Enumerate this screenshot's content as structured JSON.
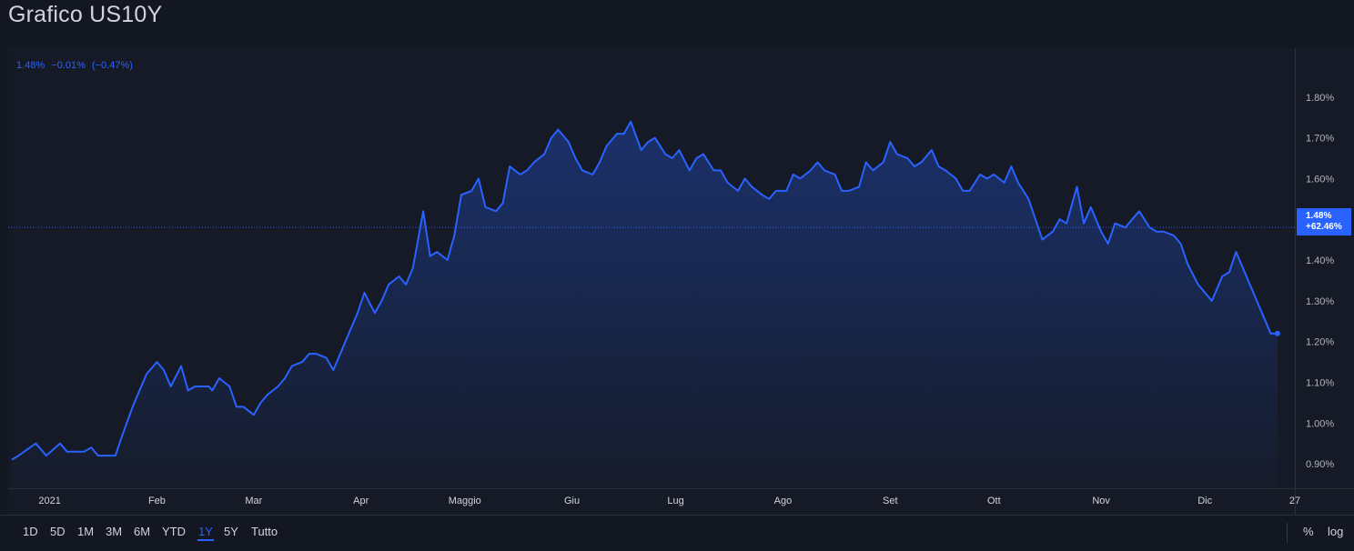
{
  "page": {
    "title": "Grafico US10Y"
  },
  "legend": {
    "value": "1.48%",
    "change": "−0.01%",
    "change_pct": "(−0.47%)"
  },
  "price_label": {
    "value": "1.48%",
    "change": "+62.46%"
  },
  "toolbar": {
    "ranges": [
      {
        "label": "1D",
        "active": false
      },
      {
        "label": "5D",
        "active": false
      },
      {
        "label": "1M",
        "active": false
      },
      {
        "label": "3M",
        "active": false
      },
      {
        "label": "6M",
        "active": false
      },
      {
        "label": "YTD",
        "active": false
      },
      {
        "label": "1Y",
        "active": true
      },
      {
        "label": "5Y",
        "active": false
      },
      {
        "label": "Tutto",
        "active": false
      }
    ],
    "percent_label": "%",
    "log_label": "log"
  },
  "colors": {
    "line": "#2962ff",
    "background": "#131722",
    "panel": "#151a26",
    "text": "#d1d4dc",
    "axis_text": "#b2b5be"
  },
  "chart_data": {
    "type": "area",
    "title": "",
    "xlabel": "",
    "ylabel": "",
    "x_tick_labels": [
      "2021",
      "Feb",
      "Mar",
      "Apr",
      "Maggio",
      "Giu",
      "Lug",
      "Ago",
      "Set",
      "Ott",
      "Nov",
      "Dic",
      "27"
    ],
    "y_tick_labels": [
      "0.90%",
      "1.00%",
      "1.10%",
      "1.20%",
      "1.30%",
      "1.40%",
      "1.50%",
      "1.60%",
      "1.70%",
      "1.80%"
    ],
    "ylim": [
      0.84,
      1.92
    ],
    "xlim": [
      "2020-12-20",
      "2021-12-27"
    ],
    "grid": false,
    "last_value": 1.48,
    "series": [
      {
        "points": [
          [
            "2020-12-21",
            0.91
          ],
          [
            "2020-12-23",
            0.92
          ],
          [
            "2020-12-28",
            0.95
          ],
          [
            "2020-12-31",
            0.92
          ],
          [
            "2021-01-04",
            0.95
          ],
          [
            "2021-01-06",
            0.93
          ],
          [
            "2021-01-08",
            0.93
          ],
          [
            "2021-01-11",
            0.93
          ],
          [
            "2021-01-13",
            0.94
          ],
          [
            "2021-01-15",
            0.92
          ],
          [
            "2021-01-19",
            0.92
          ],
          [
            "2021-01-20",
            0.92
          ],
          [
            "2021-01-22",
            0.97
          ],
          [
            "2021-01-25",
            1.04
          ],
          [
            "2021-01-27",
            1.08
          ],
          [
            "2021-01-29",
            1.12
          ],
          [
            "2021-02-01",
            1.15
          ],
          [
            "2021-02-03",
            1.13
          ],
          [
            "2021-02-05",
            1.09
          ],
          [
            "2021-02-08",
            1.14
          ],
          [
            "2021-02-10",
            1.08
          ],
          [
            "2021-02-12",
            1.09
          ],
          [
            "2021-02-16",
            1.09
          ],
          [
            "2021-02-17",
            1.08
          ],
          [
            "2021-02-19",
            1.11
          ],
          [
            "2021-02-22",
            1.09
          ],
          [
            "2021-02-24",
            1.04
          ],
          [
            "2021-02-26",
            1.04
          ],
          [
            "2021-03-01",
            1.02
          ],
          [
            "2021-03-03",
            1.05
          ],
          [
            "2021-03-05",
            1.07
          ],
          [
            "2021-03-08",
            1.09
          ],
          [
            "2021-03-10",
            1.11
          ],
          [
            "2021-03-12",
            1.14
          ],
          [
            "2021-03-15",
            1.15
          ],
          [
            "2021-03-17",
            1.17
          ],
          [
            "2021-03-19",
            1.17
          ],
          [
            "2021-03-22",
            1.16
          ],
          [
            "2021-03-24",
            1.13
          ],
          [
            "2021-03-26",
            1.17
          ],
          [
            "2021-03-29",
            1.23
          ],
          [
            "2021-03-31",
            1.27
          ],
          [
            "2021-04-02",
            1.32
          ],
          [
            "2021-04-05",
            1.27
          ],
          [
            "2021-04-07",
            1.3
          ],
          [
            "2021-04-09",
            1.34
          ],
          [
            "2021-04-12",
            1.36
          ],
          [
            "2021-04-14",
            1.34
          ],
          [
            "2021-04-16",
            1.38
          ],
          [
            "2021-04-19",
            1.52
          ],
          [
            "2021-04-21",
            1.41
          ],
          [
            "2021-04-23",
            1.42
          ],
          [
            "2021-04-26",
            1.4
          ],
          [
            "2021-04-28",
            1.46
          ],
          [
            "2021-04-30",
            1.56
          ],
          [
            "2021-05-03",
            1.57
          ],
          [
            "2021-05-05",
            1.6
          ],
          [
            "2021-05-07",
            1.53
          ],
          [
            "2021-05-10",
            1.52
          ],
          [
            "2021-05-12",
            1.54
          ],
          [
            "2021-05-14",
            1.63
          ],
          [
            "2021-05-17",
            1.61
          ],
          [
            "2021-05-19",
            1.62
          ],
          [
            "2021-05-21",
            1.64
          ],
          [
            "2021-05-24",
            1.66
          ],
          [
            "2021-05-26",
            1.7
          ],
          [
            "2021-05-28",
            1.72
          ],
          [
            "2021-05-31",
            1.69
          ],
          [
            "2021-06-02",
            1.65
          ],
          [
            "2021-06-04",
            1.62
          ],
          [
            "2021-06-07",
            1.61
          ],
          [
            "2021-06-09",
            1.64
          ],
          [
            "2021-06-11",
            1.68
          ],
          [
            "2021-06-14",
            1.71
          ],
          [
            "2021-06-16",
            1.71
          ],
          [
            "2021-06-18",
            1.74
          ],
          [
            "2021-06-21",
            1.67
          ],
          [
            "2021-06-23",
            1.69
          ],
          [
            "2021-06-25",
            1.7
          ],
          [
            "2021-06-28",
            1.66
          ],
          [
            "2021-06-30",
            1.65
          ],
          [
            "2021-07-02",
            1.67
          ],
          [
            "2021-07-05",
            1.62
          ],
          [
            "2021-07-07",
            1.65
          ],
          [
            "2021-07-09",
            1.66
          ],
          [
            "2021-07-12",
            1.62
          ],
          [
            "2021-07-14",
            1.62
          ],
          [
            "2021-07-16",
            1.59
          ],
          [
            "2021-07-19",
            1.57
          ],
          [
            "2021-07-21",
            1.6
          ],
          [
            "2021-07-23",
            1.58
          ],
          [
            "2021-07-26",
            1.56
          ],
          [
            "2021-07-28",
            1.55
          ],
          [
            "2021-07-30",
            1.57
          ],
          [
            "2021-08-02",
            1.57
          ],
          [
            "2021-08-04",
            1.61
          ],
          [
            "2021-08-06",
            1.6
          ],
          [
            "2021-08-09",
            1.62
          ],
          [
            "2021-08-11",
            1.64
          ],
          [
            "2021-08-13",
            1.62
          ],
          [
            "2021-08-16",
            1.61
          ],
          [
            "2021-08-18",
            1.57
          ],
          [
            "2021-08-20",
            1.57
          ],
          [
            "2021-08-23",
            1.58
          ],
          [
            "2021-08-25",
            1.64
          ],
          [
            "2021-08-27",
            1.62
          ],
          [
            "2021-08-30",
            1.64
          ],
          [
            "2021-09-01",
            1.69
          ],
          [
            "2021-09-03",
            1.66
          ],
          [
            "2021-09-06",
            1.65
          ],
          [
            "2021-09-08",
            1.63
          ],
          [
            "2021-09-10",
            1.64
          ],
          [
            "2021-09-13",
            1.67
          ],
          [
            "2021-09-15",
            1.63
          ],
          [
            "2021-09-17",
            1.62
          ],
          [
            "2021-09-20",
            1.6
          ],
          [
            "2021-09-22",
            1.57
          ],
          [
            "2021-09-24",
            1.57
          ],
          [
            "2021-09-27",
            1.61
          ],
          [
            "2021-09-29",
            1.6
          ],
          [
            "2021-10-01",
            1.61
          ],
          [
            "2021-10-04",
            1.59
          ],
          [
            "2021-10-06",
            1.63
          ],
          [
            "2021-10-08",
            1.59
          ],
          [
            "2021-10-11",
            1.55
          ],
          [
            "2021-10-13",
            1.5
          ],
          [
            "2021-10-15",
            1.45
          ],
          [
            "2021-10-18",
            1.47
          ],
          [
            "2021-10-20",
            1.5
          ],
          [
            "2021-10-22",
            1.49
          ],
          [
            "2021-10-25",
            1.58
          ],
          [
            "2021-10-27",
            1.49
          ],
          [
            "2021-10-29",
            1.53
          ],
          [
            "2021-11-01",
            1.47
          ],
          [
            "2021-11-03",
            1.44
          ],
          [
            "2021-11-05",
            1.49
          ],
          [
            "2021-11-08",
            1.48
          ],
          [
            "2021-11-10",
            1.5
          ],
          [
            "2021-11-12",
            1.52
          ],
          [
            "2021-11-15",
            1.48
          ],
          [
            "2021-11-17",
            1.47
          ],
          [
            "2021-11-19",
            1.47
          ],
          [
            "2021-11-22",
            1.46
          ],
          [
            "2021-11-24",
            1.44
          ],
          [
            "2021-11-26",
            1.39
          ],
          [
            "2021-11-29",
            1.34
          ],
          [
            "2021-12-01",
            1.32
          ],
          [
            "2021-12-03",
            1.3
          ],
          [
            "2021-12-06",
            1.36
          ],
          [
            "2021-12-08",
            1.37
          ],
          [
            "2021-12-10",
            1.42
          ],
          [
            "2021-12-13",
            1.36
          ],
          [
            "2021-12-15",
            1.32
          ],
          [
            "2021-12-17",
            1.28
          ],
          [
            "2021-12-20",
            1.22
          ],
          [
            "2021-12-22",
            1.22
          ]
        ]
      }
    ]
  }
}
